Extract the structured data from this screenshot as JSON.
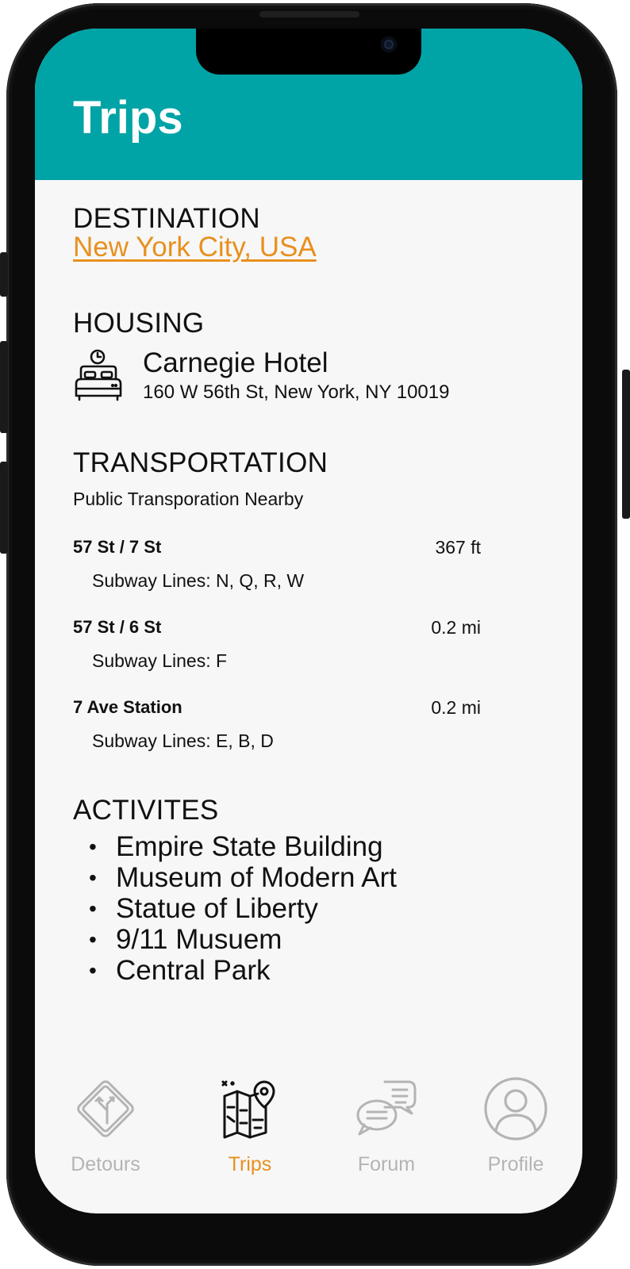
{
  "header": {
    "title": "Trips"
  },
  "destination": {
    "heading": "DESTINATION",
    "value": "New York City, USA"
  },
  "housing": {
    "heading": "HOUSING",
    "name": "Carnegie Hotel",
    "address": "160 W 56th St, New York, NY 10019",
    "icon": "bed-clock-icon"
  },
  "transportation": {
    "heading": "TRANSPORTATION",
    "subtitle": "Public Transporation Nearby",
    "stations": [
      {
        "name": "57 St / 7 St",
        "distance": "367 ft",
        "lines": "Subway Lines: N, Q, R, W"
      },
      {
        "name": "57 St / 6 St",
        "distance": "0.2 mi",
        "lines": "Subway Lines: F"
      },
      {
        "name": "7 Ave Station",
        "distance": "0.2 mi",
        "lines": "Subway Lines: E, B, D"
      }
    ]
  },
  "activities": {
    "heading": "ACTIVITES",
    "items": [
      "Empire State Building",
      "Museum of Modern Art",
      "Statue of Liberty",
      "9/11 Musuem",
      "Central Park"
    ]
  },
  "tabbar": {
    "tabs": [
      {
        "label": "Detours",
        "icon": "road-sign-icon",
        "active": false
      },
      {
        "label": "Trips",
        "icon": "map-pin-icon",
        "active": true
      },
      {
        "label": "Forum",
        "icon": "chat-bubbles-icon",
        "active": false
      },
      {
        "label": "Profile",
        "icon": "user-circle-icon",
        "active": false
      }
    ]
  },
  "colors": {
    "header": "#00a3a6",
    "accent": "#e8901e",
    "inactive": "#b4b4b4",
    "background": "#f7f7f7"
  }
}
